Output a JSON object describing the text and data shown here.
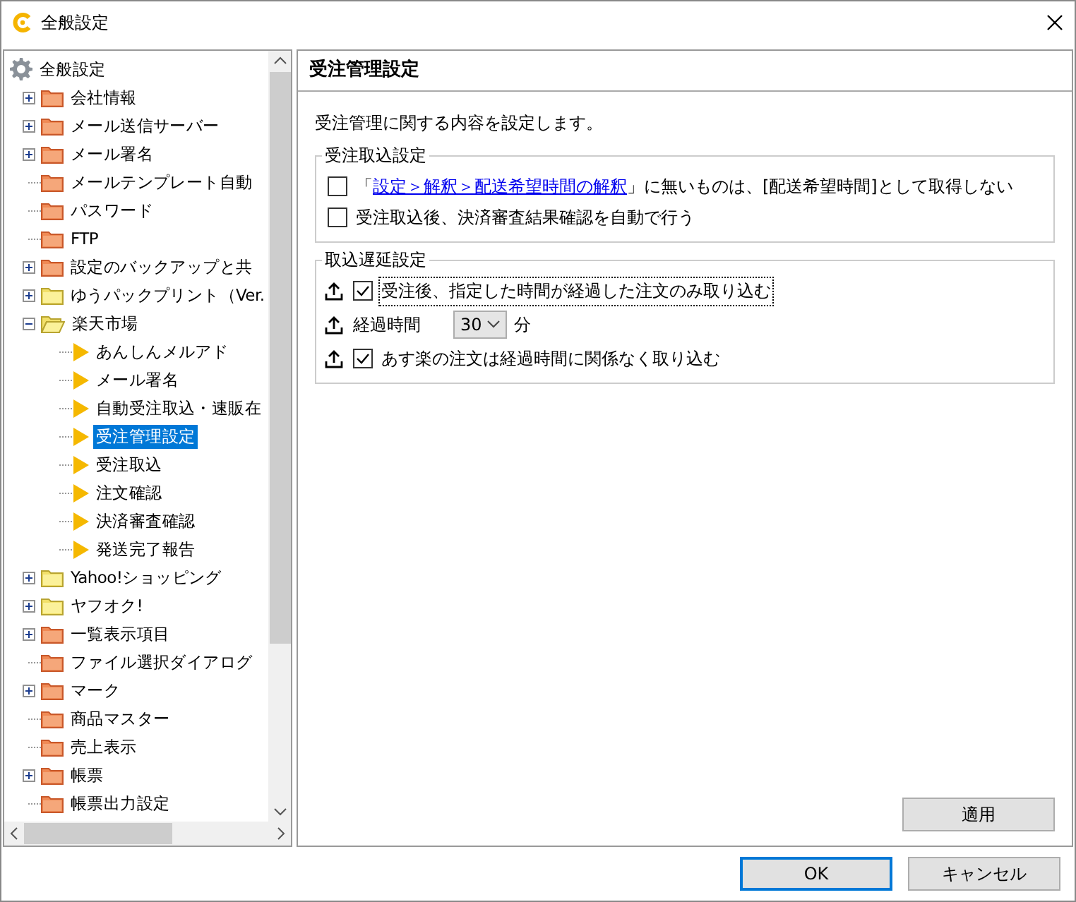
{
  "window": {
    "title": "全般設定"
  },
  "tree": {
    "items": [
      {
        "label": "全般設定",
        "kind": "gear",
        "selected": false,
        "children": [
          {
            "label": "会社情報",
            "kind": "folder",
            "expanded": false,
            "selected": false
          },
          {
            "label": "メール送信サーバー",
            "kind": "folder",
            "expanded": false,
            "selected": false
          },
          {
            "label": "メール署名",
            "kind": "folder",
            "expanded": false,
            "selected": false
          },
          {
            "label": "メールテンプレート自動",
            "kind": "folder",
            "selected": false
          },
          {
            "label": "パスワード",
            "kind": "folder",
            "selected": false
          },
          {
            "label": "FTP",
            "kind": "folder",
            "selected": false
          },
          {
            "label": "設定のバックアップと共",
            "kind": "folder",
            "expanded": false,
            "selected": false
          },
          {
            "label": "ゆうパックプリント（Ver.",
            "kind": "yellowfolder",
            "expanded": false,
            "selected": false
          },
          {
            "label": "楽天市場",
            "kind": "openfolder",
            "expanded": true,
            "selected": false,
            "children": [
              {
                "label": "あんしんメルアド",
                "kind": "arrow",
                "selected": false
              },
              {
                "label": "メール署名",
                "kind": "arrow",
                "selected": false
              },
              {
                "label": "自動受注取込・速販在",
                "kind": "arrow",
                "selected": false
              },
              {
                "label": "受注管理設定",
                "kind": "arrow",
                "selected": true
              },
              {
                "label": "受注取込",
                "kind": "arrow",
                "selected": false
              },
              {
                "label": "注文確認",
                "kind": "arrow",
                "selected": false
              },
              {
                "label": "決済審査確認",
                "kind": "arrow",
                "selected": false
              },
              {
                "label": "発送完了報告",
                "kind": "arrow",
                "selected": false
              }
            ]
          },
          {
            "label": "Yahoo!ショッピング",
            "kind": "yellowfolder",
            "expanded": false,
            "selected": false
          },
          {
            "label": "ヤフオク!",
            "kind": "yellowfolder",
            "expanded": false,
            "selected": false
          },
          {
            "label": "一覧表示項目",
            "kind": "folder",
            "expanded": false,
            "selected": false
          },
          {
            "label": "ファイル選択ダイアログ",
            "kind": "folder",
            "selected": false
          },
          {
            "label": "マーク",
            "kind": "folder",
            "expanded": false,
            "selected": false
          },
          {
            "label": "商品マスター",
            "kind": "folder",
            "selected": false
          },
          {
            "label": "売上表示",
            "kind": "folder",
            "selected": false
          },
          {
            "label": "帳票",
            "kind": "folder",
            "expanded": false,
            "selected": false
          },
          {
            "label": "帳票出力設定",
            "kind": "folder",
            "selected": false
          }
        ]
      }
    ]
  },
  "panel": {
    "title": "受注管理設定",
    "description": "受注管理に関する内容を設定します。",
    "groups": [
      {
        "legend": "受注取込設定",
        "rows": [
          {
            "kind": "checkbox",
            "checked": false,
            "icon": false,
            "prefix": "「",
            "link": "設定＞解釈＞配送希望時間の解釈",
            "label": "」に無いものは、[配送希望時間]として取得しない"
          },
          {
            "kind": "checkbox",
            "checked": false,
            "icon": false,
            "label": "受注取込後、決済審査結果確認を自動で行う"
          }
        ]
      },
      {
        "legend": "取込遅延設定",
        "rows": [
          {
            "kind": "checkbox",
            "checked": true,
            "focused": true,
            "icon": true,
            "label": "受注後、指定した時間が経過した注文のみ取り込む"
          },
          {
            "kind": "select",
            "icon": true,
            "label": "経過時間",
            "value": "30",
            "unit": "分"
          },
          {
            "kind": "checkbox",
            "checked": true,
            "icon": true,
            "label": "あす楽の注文は経過時間に関係なく取り込む"
          }
        ]
      }
    ],
    "apply_button": "適用"
  },
  "buttons": [
    {
      "label": "OK",
      "default": true
    },
    {
      "label": "キャンセル",
      "default": false
    }
  ]
}
